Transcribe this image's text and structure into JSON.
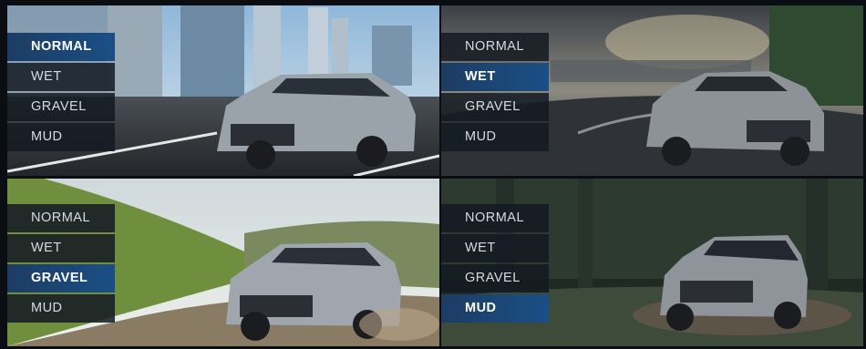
{
  "panels": [
    {
      "scene": "city-road",
      "modes": [
        "NORMAL",
        "WET",
        "GRAVEL",
        "MUD"
      ],
      "selected": "NORMAL"
    },
    {
      "scene": "wet-road",
      "modes": [
        "NORMAL",
        "WET",
        "GRAVEL",
        "MUD"
      ],
      "selected": "WET"
    },
    {
      "scene": "gravel-hill",
      "modes": [
        "NORMAL",
        "WET",
        "GRAVEL",
        "MUD"
      ],
      "selected": "GRAVEL"
    },
    {
      "scene": "mud-forest",
      "modes": [
        "NORMAL",
        "WET",
        "GRAVEL",
        "MUD"
      ],
      "selected": "MUD"
    }
  ],
  "colors": {
    "active_mode": "#1a4f86",
    "inactive_mode": "#141a22",
    "car_body": "#9aa2aa"
  }
}
